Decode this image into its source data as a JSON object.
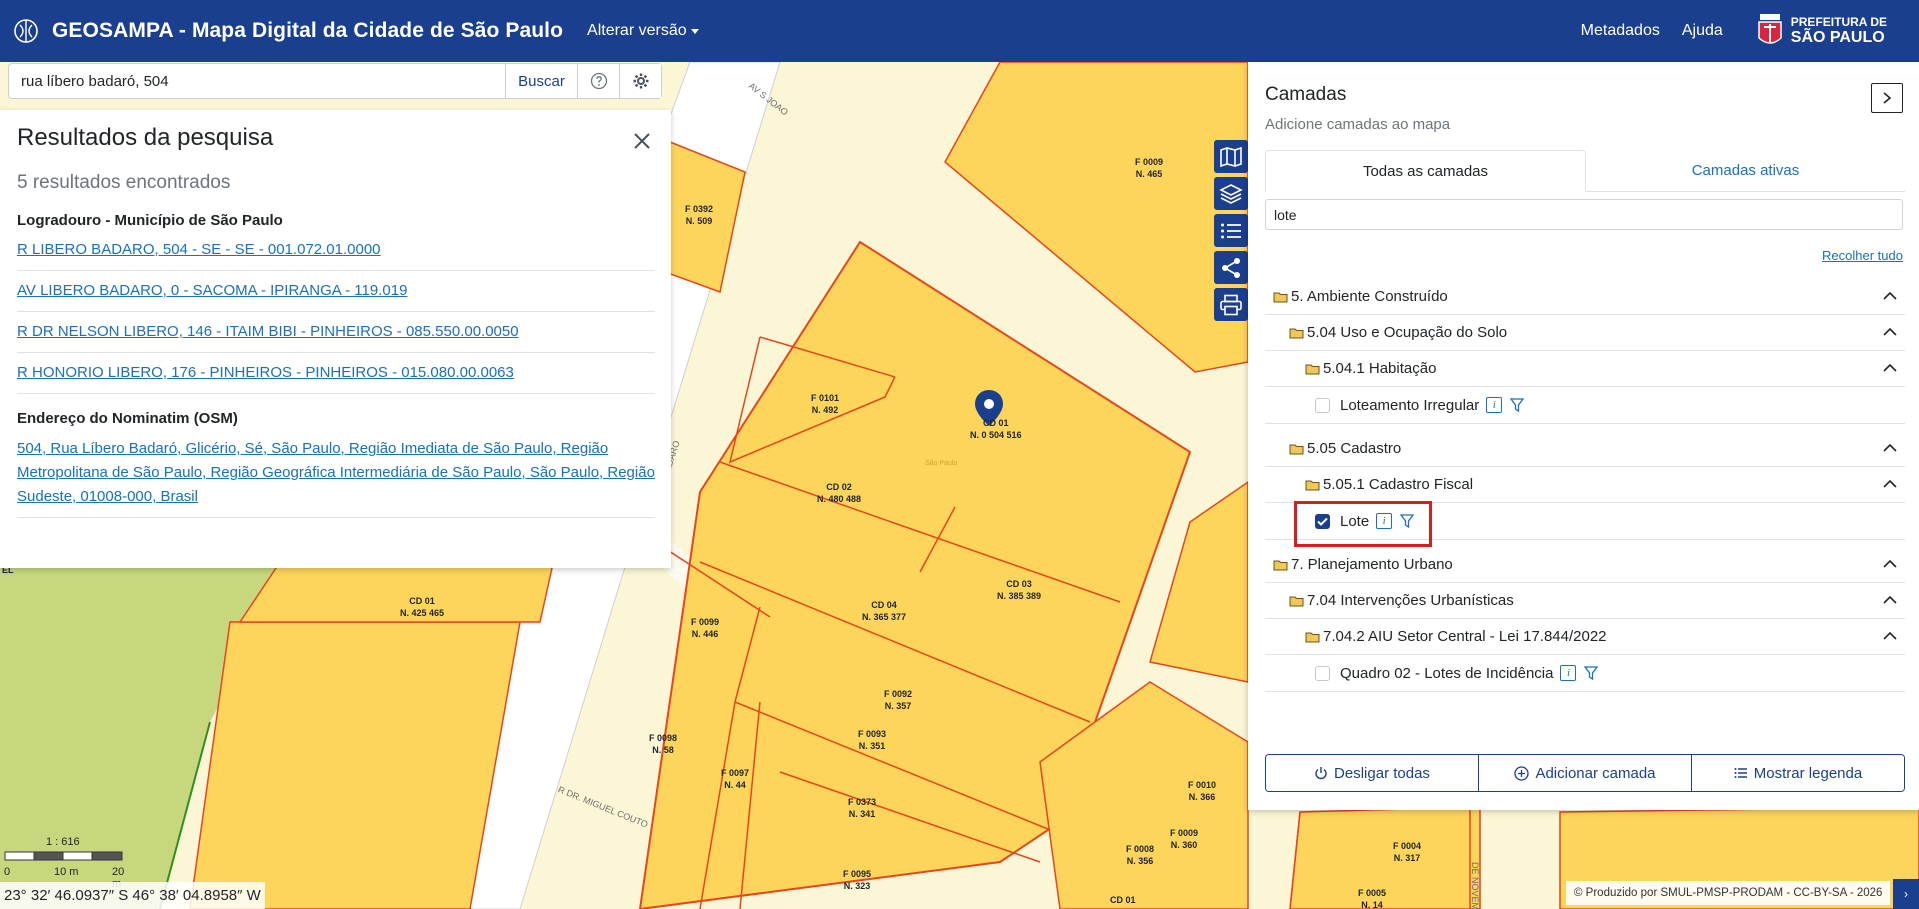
{
  "header": {
    "title": "GEOSAMPA - Mapa Digital da Cidade de São Paulo",
    "version_label": "Alterar versão",
    "metadata_label": "Metadados",
    "help_label": "Ajuda",
    "prefeitura_line1": "PREFEITURA DE",
    "prefeitura_line2": "SÃO PAULO"
  },
  "search": {
    "value": "rua líbero badaró, 504",
    "button_label": "Buscar"
  },
  "results": {
    "title": "Resultados da pesquisa",
    "count_text": "5 resultados encontrados",
    "group1_heading": "Logradouro - Município de São Paulo",
    "group1_items": [
      "R LIBERO BADARO, 504 - SE - SE - 001.072.01.0000",
      "AV LIBERO BADARO, 0 - SACOMA - IPIRANGA - 119.019",
      "R DR NELSON LIBERO, 146 - ITAIM BIBI - PINHEIROS - 085.550.00.0050",
      "R HONORIO LIBERO, 176 - PINHEIROS - PINHEIROS - 015.080.00.0063"
    ],
    "group2_heading": "Endereço do Nominatim (OSM)",
    "group2_item": "504, Rua Líbero Badaró, Glicério, Sé, São Paulo, Região Imediata de São Paulo, Região Metropolitana de São Paulo, Região Geográfica Intermediária de São Paulo, São Paulo, Região Sudeste, 01008-000, Brasil"
  },
  "layers": {
    "title": "Camadas",
    "subtitle": "Adicione camadas ao mapa",
    "tab_all": "Todas as camadas",
    "tab_active": "Camadas ativas",
    "filter_value": "lote",
    "collapse_all": "Recolher tudo",
    "tree": {
      "n1": "5. Ambiente Construído",
      "n1_1": "5.04 Uso e Ocupação do Solo",
      "n1_1_1": "5.04.1 Habitação",
      "leaf1": "Loteamento Irregular",
      "n1_2": "5.05 Cadastro",
      "n1_2_1": "5.05.1 Cadastro Fiscal",
      "leaf2": "Lote",
      "n2": "7. Planejamento Urbano",
      "n2_1": "7.04 Intervenções Urbanísticas",
      "n2_1_1": "7.04.2 AIU Setor Central - Lei 17.844/2022",
      "leaf3": "Quadro 02 - Lotes de Incidência"
    },
    "btn_off": "Desligar todas",
    "btn_add": "Adicionar camada",
    "btn_legend": "Mostrar legenda"
  },
  "map": {
    "labels": [
      {
        "a": "F 0009",
        "b": "N. 465"
      },
      {
        "a": "F 0392",
        "b": "N. 509"
      },
      {
        "a": "F 0101",
        "b": "N. 492"
      },
      {
        "a": "CD 01",
        "b": "N. 0 504 516"
      },
      {
        "a": "CD 02",
        "b": "N. 480 488"
      },
      {
        "a": "CD 03",
        "b": "N. 385 389"
      },
      {
        "a": "CD 04",
        "b": "N. 365 377"
      },
      {
        "a": "F 0099",
        "b": "N. 446"
      },
      {
        "a": "CD 01",
        "b": "N. 425 465"
      },
      {
        "a": "F 0092",
        "b": "N. 357"
      },
      {
        "a": "F 0093",
        "b": "N. 351"
      },
      {
        "a": "F 0098",
        "b": "N. 58"
      },
      {
        "a": "F 0097",
        "b": "N. 44"
      },
      {
        "a": "F 0373",
        "b": "N. 341"
      },
      {
        "a": "F 0095",
        "b": "N. 323"
      },
      {
        "a": "F 0010",
        "b": "N. 366"
      },
      {
        "a": "F 0009",
        "b": "N. 360"
      },
      {
        "a": "F 0008",
        "b": "N. 356"
      },
      {
        "a": "F 0004",
        "b": "N. 317"
      },
      {
        "a": "F 0005",
        "b": "N. 14"
      },
      {
        "a": "CD 01",
        "b": ""
      }
    ],
    "street1": "AV S JOAO",
    "street2": "R DR. MIGUEL COUTO",
    "street3": "BADARO",
    "street4": "DE NOVEMBRO",
    "sao_paulo_small": "São Paulo",
    "edge_label": "EL"
  },
  "scale": {
    "ratio": "1 : 616",
    "t0": "0",
    "t1": "10 m",
    "t2": "20 m"
  },
  "coords": "23° 32′ 46.0937″ S 46° 38′ 04.8958″ W",
  "credits": "© Produzido por SMUL-PMSP-PRODAM - CC-BY-SA - 2026",
  "colors": {
    "brand": "#1b3f8f",
    "parcel_fill": "#fdd55a",
    "parcel_stroke": "#e8451c",
    "highlight": "#d61f1f"
  }
}
